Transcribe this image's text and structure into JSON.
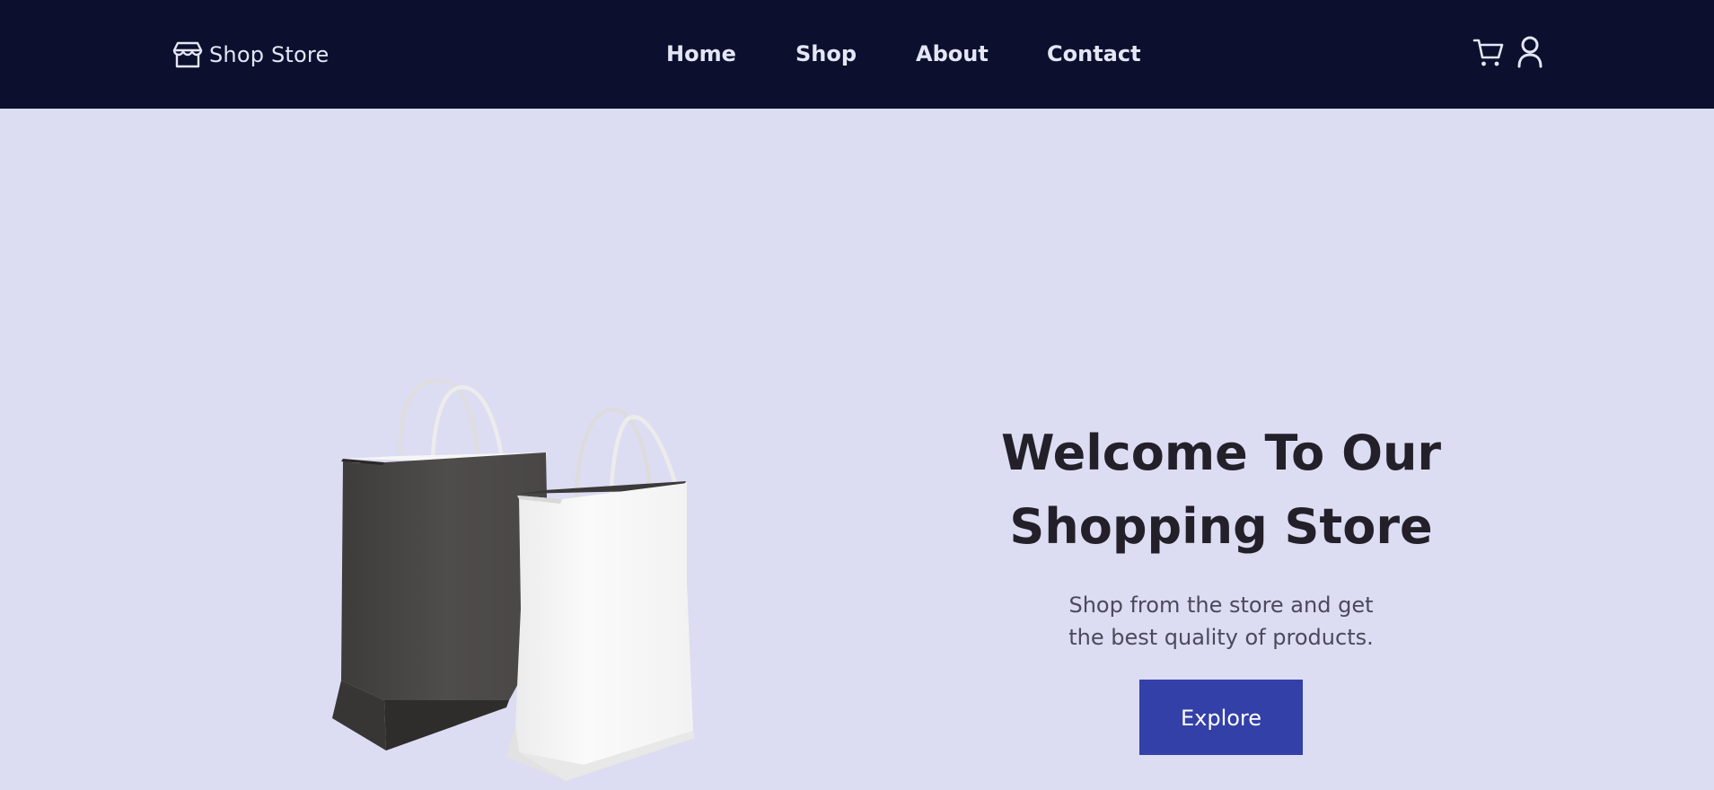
{
  "navbar": {
    "brand": {
      "label": "Shop Store",
      "icon": "storefront-icon"
    },
    "links": [
      {
        "label": "Home"
      },
      {
        "label": "Shop"
      },
      {
        "label": "About"
      },
      {
        "label": "Contact"
      }
    ],
    "icons": [
      "cart-icon",
      "user-icon"
    ]
  },
  "hero": {
    "title_line1": "Welcome To Our",
    "title_line2": "Shopping Store",
    "subtitle_line1": "Shop from the store and get",
    "subtitle_line2": "the best quality of products.",
    "button_label": "Explore",
    "image": "shopping-bags"
  },
  "colors": {
    "nav_background": "#0c102e",
    "page_background": "#dcdcf2",
    "accent": "#3340a8",
    "heading": "#23202a",
    "body_text": "#4a4a5c",
    "nav_text": "#e4e6f6"
  }
}
